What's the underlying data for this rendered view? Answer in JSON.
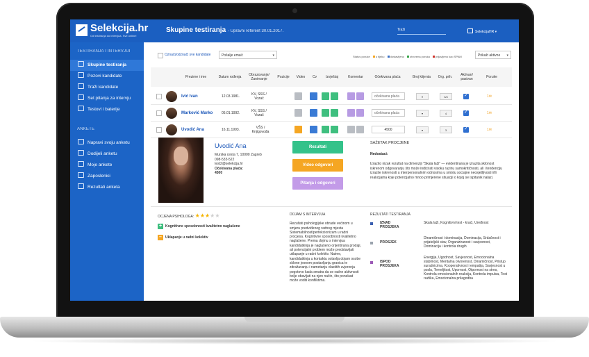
{
  "app": {
    "logo_name": "Selekcija.hr",
    "logo_tag": "Od testiranja do intervjua. Sve online!",
    "page_title": "Skupine testiranja",
    "page_sub": "- Upravni referent 30.01.2017.",
    "search_placeholder": "Traži",
    "user": "SelekcijaHR ▾"
  },
  "sidebar": {
    "section1": "TESTIRANJA I INTERVJUI",
    "items1": [
      "Skupine testiranja",
      "Pozovi kandidate",
      "Traži kandidate",
      "Set pitanja za intervju",
      "Testovi i baterije"
    ],
    "section2": "ANKETE",
    "items2": [
      "Napravi svoju anketu",
      "Dodijeli anketu",
      "Moje ankete",
      "Zaposlenici",
      "Rezultati anketa"
    ]
  },
  "filter": {
    "select_all": "Označi/odznači sve kandidate",
    "send_email": "Pošalje email:",
    "status_label": "Status poruke",
    "legend": [
      "u tijeku",
      "dostavljeno",
      "otvorena poruka",
      "prijavljeno kao SPAM"
    ],
    "show": "Prikaži aktivne"
  },
  "colors": {
    "brand": "#1b5fc1",
    "sidebar": "#1c64c6",
    "legend": [
      "#f5a623",
      "#3a6fc4",
      "#3aa54a",
      "#d0342c"
    ]
  },
  "table": {
    "headers": [
      "Prezime i ime",
      "Datum rođenja",
      "Obrazovanje/ Zanimanje",
      "Pozicije",
      "Video",
      "Cv",
      "Izvještaj",
      "Komentar",
      "Očekivana plaća",
      "Broj klijenta",
      "Org. prih.",
      "Aktivan/ pasivan",
      "Poruke"
    ],
    "rows": [
      {
        "name": "Ivić Ivan",
        "dob": "12.03.1981.",
        "edu": "KV, SSS / Vozač",
        "salary_placeholder": "očekivana plaća",
        "org": "3/4",
        "poruke": "1"
      },
      {
        "name": "Marković Marko",
        "dob": "05.01.1992.",
        "edu": "KV, SSS / Vozač",
        "salary_placeholder": "očekivana plaća",
        "org": "4",
        "poruke": "1"
      },
      {
        "name": "Uvodić Ana",
        "dob": "16.11.1993.",
        "edu": "VŠS / Knjigovođa",
        "salary": "4500",
        "org": "3",
        "poruke": "1"
      }
    ]
  },
  "detail": {
    "name": "Uvodić Ana",
    "address": "Murska cesta 7, 10000 Zagreb",
    "phone": "098-533-522",
    "email": "test2@selekcija.hr",
    "salary_label": "Očekivana plaća:",
    "salary": "4500",
    "btn_results": "Rezultati",
    "btn_video": "Video odgovori",
    "btn_questions": "Pitanja i odgovori",
    "summary_title": "SAŽETAK PROCJENE",
    "summary_weak": "Nedostaci:",
    "summary_text": "Izrazito nizak rezultat na dimenziji \"Skala laži\" — evidentirana je izrazita sklonost iskrenom odgovaranju što može indicirati visoku razinu samokritičnosti, ali i tendenciju izrazite iskrenosti u interpersonalnim odnosima u smislu sociajne neosjetljivosti i/ili reakcijama koje potencijalno mnoo primjerene situaciji o kojoj se ispitanik nalazi."
  },
  "bottom": {
    "rating_label": "OCJENA PSIHOLOGA:",
    "rating": 3,
    "plus_item": "Kognitivne sposobnosti kvalitetno naglašene",
    "minus_item": "Uklapanje u radni kolektiv",
    "interview_title": "DOJAM S INTERVJUA",
    "interview_text": "Rezultati psihologijske obrade većinom u smjeru predviđenog radnog mjesta Sistemabilnost/perfekcionizam u radni procjesa. Kognitivne sposobnosti kvalitetno naglašene. Prema dojmu s intervjua kandidatkinja je naglašeno orijentirana prodaji, ali potencijalni problem može predstavljati uklapanje u radni kolektiv. Naime, kandidatkinja u kontaktu ostavlja dojam osobe sklone jesnom postavljanju granica te zdražavanju i nametanju vlastitih uvjerenja pogotovo kada smatra da se radne aktivnosti bolje obavljati na njen način, što ponekad može voditi konfliktima.",
    "results_title": "REZULTATI TESTIRANJA",
    "results": [
      {
        "label": "IZNAD PROSJEKA",
        "text": "Skala laži, Kognitivni test - kraći, Uređnost",
        "color": "#3a5fb0"
      },
      {
        "label": "PROSJEK",
        "text": "Dinamičnost i dominacija, Dominacija, Srdačnost i prijateljski stav, Organiziranost i savjesnost, Dominacija i kontrola drugih",
        "color": "#9aa3ad"
      },
      {
        "label": "ISPOD PROSJEKA",
        "text": "Energija, Ugodnost, Savjesnost, Emocionalna stabilnost, Mentalna otvorenost, Dinamičnost, Pristup suradnicima, Kooperativnost i empatija, Savjesnost u poslu, Temeljitost, Upornost, Otpornost na stres, Kontrola emocionalnih reakcija, Kontrola impulsa, Test razlika, Emocionalna prilagodba",
        "color": "#9b59b6"
      }
    ]
  }
}
